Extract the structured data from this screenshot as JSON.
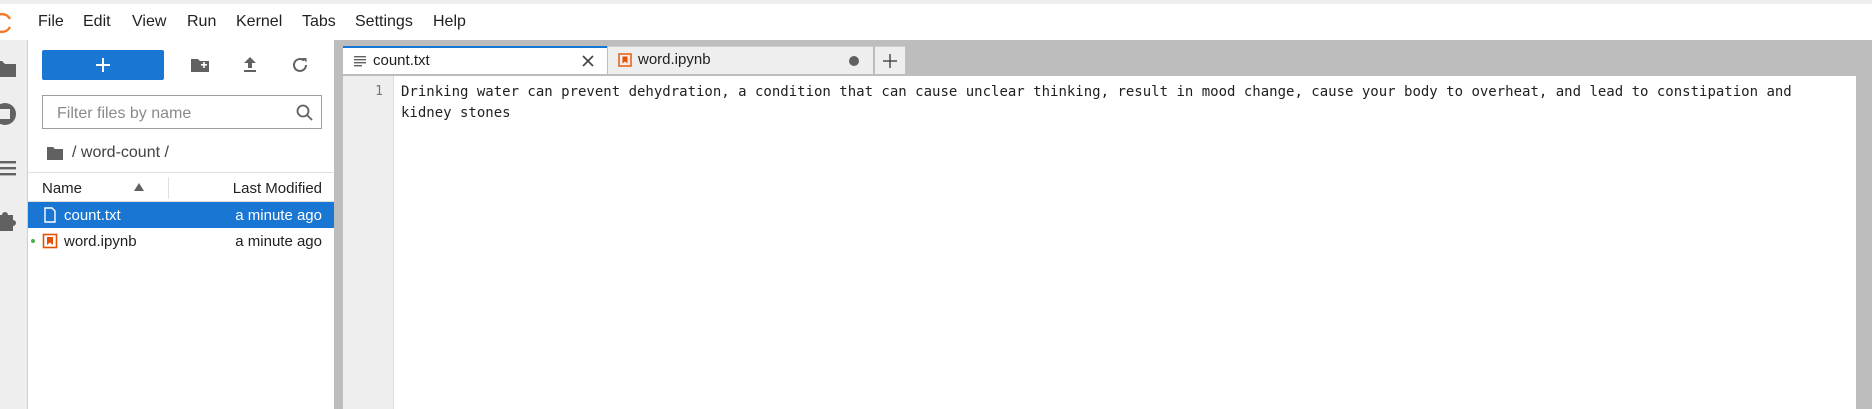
{
  "menu": {
    "items": [
      "File",
      "Edit",
      "View",
      "Run",
      "Kernel",
      "Tabs",
      "Settings",
      "Help"
    ]
  },
  "colors": {
    "accent": "#1976d2",
    "logo": "#f37726",
    "notebook_icon": "#e65100",
    "kernel_dot": "#4caf50"
  },
  "icons": {
    "new_launcher": "plus-icon",
    "new_folder": "new-folder-icon",
    "upload": "upload-icon",
    "refresh": "refresh-icon",
    "search": "search-icon"
  },
  "filebrowser": {
    "new_label": "+",
    "filter_placeholder": "Filter files by name",
    "filter_value": "",
    "breadcrumb": "/ word-count /",
    "columns": {
      "name": "Name",
      "modified": "Last Modified"
    },
    "files": [
      {
        "name": "count.txt",
        "modified": "a minute ago",
        "type": "text",
        "selected": true
      },
      {
        "name": "word.ipynb",
        "modified": "a minute ago",
        "type": "notebook",
        "selected": false
      }
    ]
  },
  "tabs": [
    {
      "label": "count.txt",
      "type": "text",
      "active": true
    },
    {
      "label": "word.ipynb",
      "type": "notebook",
      "active": false
    }
  ],
  "editor": {
    "line_numbers": [
      "1"
    ],
    "content": "Drinking water can prevent dehydration, a condition that can cause unclear thinking, result in mood change, cause your body to overheat, and lead to constipation and kidney stones"
  }
}
